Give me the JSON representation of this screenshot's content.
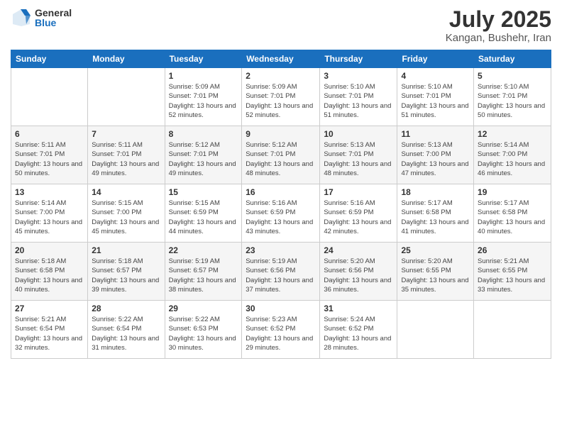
{
  "logo": {
    "general": "General",
    "blue": "Blue"
  },
  "title": {
    "month_year": "July 2025",
    "location": "Kangan, Bushehr, Iran"
  },
  "weekdays": [
    "Sunday",
    "Monday",
    "Tuesday",
    "Wednesday",
    "Thursday",
    "Friday",
    "Saturday"
  ],
  "weeks": [
    [
      {
        "day": "",
        "info": ""
      },
      {
        "day": "",
        "info": ""
      },
      {
        "day": "1",
        "info": "Sunrise: 5:09 AM\nSunset: 7:01 PM\nDaylight: 13 hours and 52 minutes."
      },
      {
        "day": "2",
        "info": "Sunrise: 5:09 AM\nSunset: 7:01 PM\nDaylight: 13 hours and 52 minutes."
      },
      {
        "day": "3",
        "info": "Sunrise: 5:10 AM\nSunset: 7:01 PM\nDaylight: 13 hours and 51 minutes."
      },
      {
        "day": "4",
        "info": "Sunrise: 5:10 AM\nSunset: 7:01 PM\nDaylight: 13 hours and 51 minutes."
      },
      {
        "day": "5",
        "info": "Sunrise: 5:10 AM\nSunset: 7:01 PM\nDaylight: 13 hours and 50 minutes."
      }
    ],
    [
      {
        "day": "6",
        "info": "Sunrise: 5:11 AM\nSunset: 7:01 PM\nDaylight: 13 hours and 50 minutes."
      },
      {
        "day": "7",
        "info": "Sunrise: 5:11 AM\nSunset: 7:01 PM\nDaylight: 13 hours and 49 minutes."
      },
      {
        "day": "8",
        "info": "Sunrise: 5:12 AM\nSunset: 7:01 PM\nDaylight: 13 hours and 49 minutes."
      },
      {
        "day": "9",
        "info": "Sunrise: 5:12 AM\nSunset: 7:01 PM\nDaylight: 13 hours and 48 minutes."
      },
      {
        "day": "10",
        "info": "Sunrise: 5:13 AM\nSunset: 7:01 PM\nDaylight: 13 hours and 48 minutes."
      },
      {
        "day": "11",
        "info": "Sunrise: 5:13 AM\nSunset: 7:00 PM\nDaylight: 13 hours and 47 minutes."
      },
      {
        "day": "12",
        "info": "Sunrise: 5:14 AM\nSunset: 7:00 PM\nDaylight: 13 hours and 46 minutes."
      }
    ],
    [
      {
        "day": "13",
        "info": "Sunrise: 5:14 AM\nSunset: 7:00 PM\nDaylight: 13 hours and 45 minutes."
      },
      {
        "day": "14",
        "info": "Sunrise: 5:15 AM\nSunset: 7:00 PM\nDaylight: 13 hours and 45 minutes."
      },
      {
        "day": "15",
        "info": "Sunrise: 5:15 AM\nSunset: 6:59 PM\nDaylight: 13 hours and 44 minutes."
      },
      {
        "day": "16",
        "info": "Sunrise: 5:16 AM\nSunset: 6:59 PM\nDaylight: 13 hours and 43 minutes."
      },
      {
        "day": "17",
        "info": "Sunrise: 5:16 AM\nSunset: 6:59 PM\nDaylight: 13 hours and 42 minutes."
      },
      {
        "day": "18",
        "info": "Sunrise: 5:17 AM\nSunset: 6:58 PM\nDaylight: 13 hours and 41 minutes."
      },
      {
        "day": "19",
        "info": "Sunrise: 5:17 AM\nSunset: 6:58 PM\nDaylight: 13 hours and 40 minutes."
      }
    ],
    [
      {
        "day": "20",
        "info": "Sunrise: 5:18 AM\nSunset: 6:58 PM\nDaylight: 13 hours and 40 minutes."
      },
      {
        "day": "21",
        "info": "Sunrise: 5:18 AM\nSunset: 6:57 PM\nDaylight: 13 hours and 39 minutes."
      },
      {
        "day": "22",
        "info": "Sunrise: 5:19 AM\nSunset: 6:57 PM\nDaylight: 13 hours and 38 minutes."
      },
      {
        "day": "23",
        "info": "Sunrise: 5:19 AM\nSunset: 6:56 PM\nDaylight: 13 hours and 37 minutes."
      },
      {
        "day": "24",
        "info": "Sunrise: 5:20 AM\nSunset: 6:56 PM\nDaylight: 13 hours and 36 minutes."
      },
      {
        "day": "25",
        "info": "Sunrise: 5:20 AM\nSunset: 6:55 PM\nDaylight: 13 hours and 35 minutes."
      },
      {
        "day": "26",
        "info": "Sunrise: 5:21 AM\nSunset: 6:55 PM\nDaylight: 13 hours and 33 minutes."
      }
    ],
    [
      {
        "day": "27",
        "info": "Sunrise: 5:21 AM\nSunset: 6:54 PM\nDaylight: 13 hours and 32 minutes."
      },
      {
        "day": "28",
        "info": "Sunrise: 5:22 AM\nSunset: 6:54 PM\nDaylight: 13 hours and 31 minutes."
      },
      {
        "day": "29",
        "info": "Sunrise: 5:22 AM\nSunset: 6:53 PM\nDaylight: 13 hours and 30 minutes."
      },
      {
        "day": "30",
        "info": "Sunrise: 5:23 AM\nSunset: 6:52 PM\nDaylight: 13 hours and 29 minutes."
      },
      {
        "day": "31",
        "info": "Sunrise: 5:24 AM\nSunset: 6:52 PM\nDaylight: 13 hours and 28 minutes."
      },
      {
        "day": "",
        "info": ""
      },
      {
        "day": "",
        "info": ""
      }
    ]
  ]
}
